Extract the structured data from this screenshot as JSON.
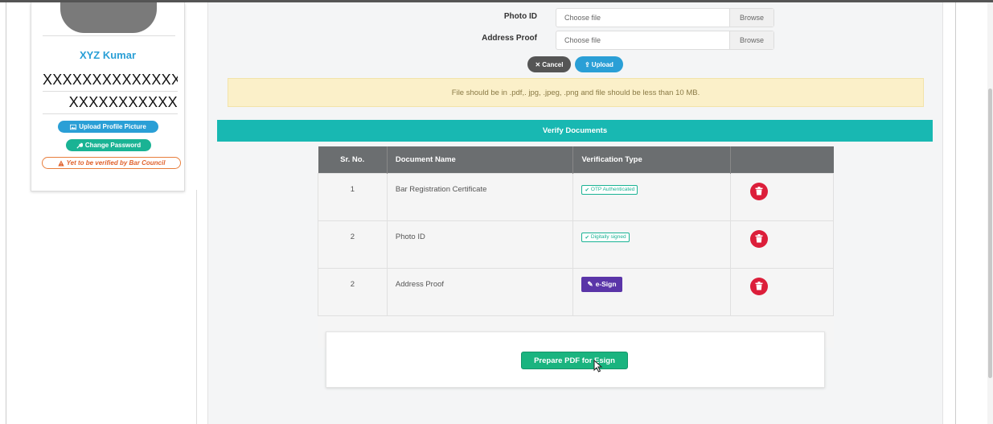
{
  "sidebar": {
    "profile_name": "XYZ Kumar",
    "masked_line_1": "XXXXXXXXXXXXXX",
    "masked_line_2": "XXXXXXXXXXX",
    "upload_picture_label": "Upload Profile Picture",
    "change_password_label": "Change Password",
    "verification_status_label": "Yet to be verified by Bar Council"
  },
  "upload_form": {
    "photo_id_label": "Photo ID",
    "photo_id_placeholder": "Choose file",
    "address_proof_label": "Address Proof",
    "address_proof_placeholder": "Choose file",
    "browse_label": "Browse",
    "cancel_label": "Cancel",
    "upload_label": "Upload",
    "notice": "File should be in .pdf,. jpg, .jpeg, .png and file should be less than 10 MB."
  },
  "verify_section": {
    "title": "Verify Documents",
    "columns": [
      "Sr. No.",
      "Document Name",
      "Verification Type",
      ""
    ],
    "rows": [
      {
        "sr": "1",
        "name": "Bar Registration Certificate",
        "verification": "OTP Authenticated",
        "kind": "tag"
      },
      {
        "sr": "2",
        "name": "Photo ID",
        "verification": "Digitally signed",
        "kind": "tag"
      },
      {
        "sr": "2",
        "name": "Address Proof",
        "verification": "e-Sign",
        "kind": "button"
      }
    ],
    "prepare_label": "Prepare PDF for Esign"
  },
  "colors": {
    "accent_blue": "#2a9fd6",
    "teal": "#18b8b2",
    "green": "#1ab47f",
    "danger": "#dc1e3a",
    "esign_purple": "#5a35a8"
  }
}
